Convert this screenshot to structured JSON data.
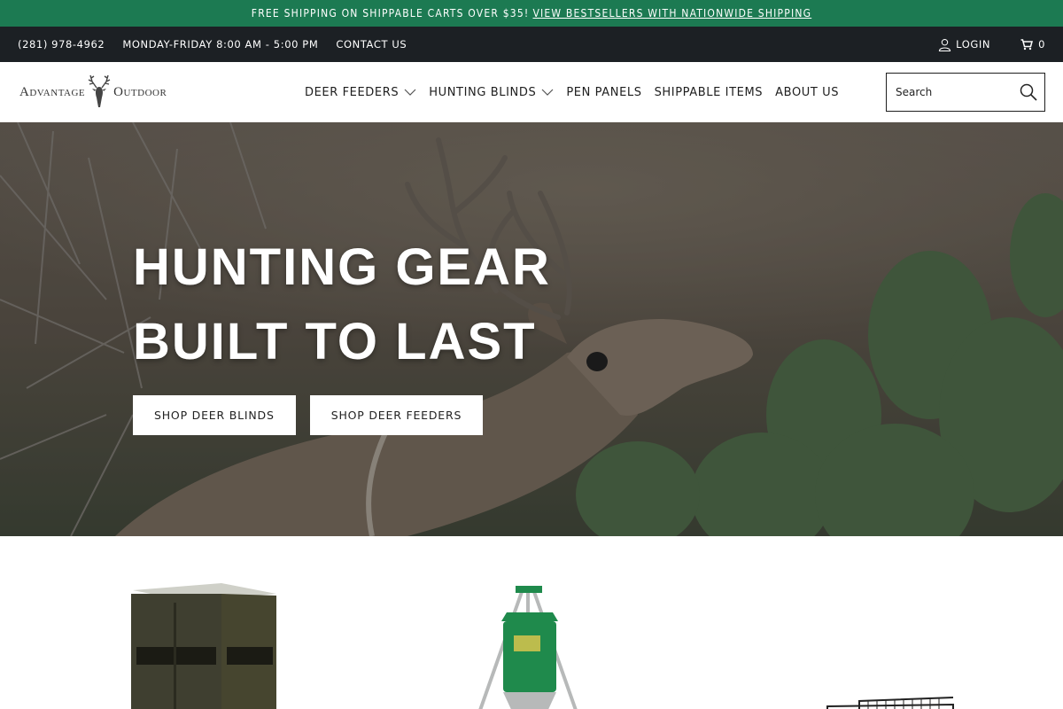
{
  "announcement": {
    "text": "FREE SHIPPING ON SHIPPABLE CARTS OVER $35!",
    "link": "VIEW BESTSELLERS WITH NATIONWIDE SHIPPING"
  },
  "utility": {
    "phone": "(281) 978-4962",
    "hours": "MONDAY-FRIDAY 8:00 AM - 5:00 PM",
    "contact": "CONTACT US",
    "login": "LOGIN",
    "cart_count": "0"
  },
  "brand": {
    "logo_left": "Advantage",
    "logo_right": "Outdoor"
  },
  "nav": {
    "items": [
      {
        "label": "DEER FEEDERS",
        "dropdown": true
      },
      {
        "label": "HUNTING BLINDS",
        "dropdown": true
      },
      {
        "label": "PEN PANELS",
        "dropdown": false
      },
      {
        "label": "SHIPPABLE ITEMS",
        "dropdown": false
      },
      {
        "label": "ABOUT US",
        "dropdown": false
      }
    ]
  },
  "search": {
    "placeholder": "Search"
  },
  "hero": {
    "line1": "HUNTING GEAR",
    "line2": "BUILT TO LAST",
    "button1": "SHOP DEER BLINDS",
    "button2": "SHOP DEER FEEDERS"
  },
  "products": {
    "items": [
      {
        "name": "deer-blind",
        "image": "hunting-blind-image"
      },
      {
        "name": "deer-feeder",
        "image": "tripod-feeder-image"
      },
      {
        "name": "pen-panel",
        "image": "pen-panel-image"
      }
    ]
  },
  "colors": {
    "announcement_bg": "#1c7a52",
    "utility_bg": "#1c2024",
    "feeder_green": "#1f8a4c"
  }
}
